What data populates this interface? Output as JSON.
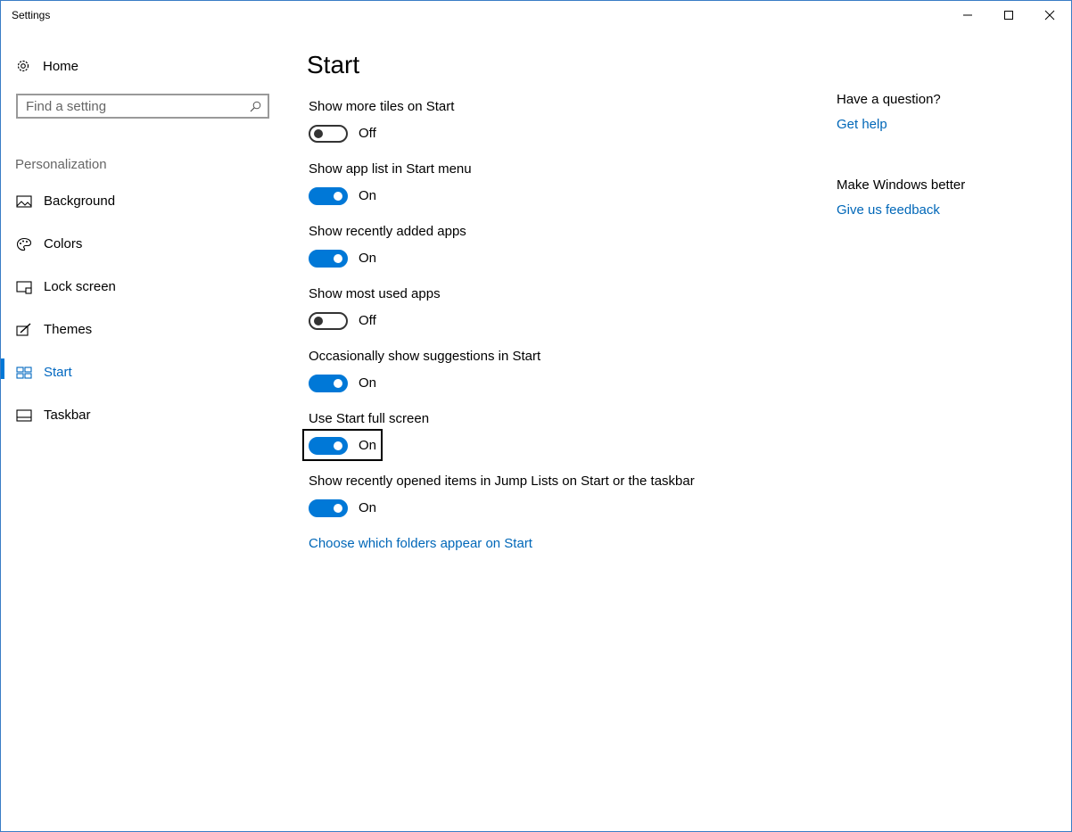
{
  "window": {
    "title": "Settings"
  },
  "nav": {
    "home_label": "Home",
    "search_placeholder": "Find a setting",
    "section_label": "Personalization",
    "items": [
      {
        "label": "Background",
        "icon": "picture-icon",
        "active": false
      },
      {
        "label": "Colors",
        "icon": "palette-icon",
        "active": false
      },
      {
        "label": "Lock screen",
        "icon": "lock-screen-icon",
        "active": false
      },
      {
        "label": "Themes",
        "icon": "themes-icon",
        "active": false
      },
      {
        "label": "Start",
        "icon": "start-icon",
        "active": true
      },
      {
        "label": "Taskbar",
        "icon": "taskbar-icon",
        "active": false
      }
    ]
  },
  "main": {
    "title": "Start",
    "settings": [
      {
        "label": "Show more tiles on Start",
        "state": "Off",
        "on": false
      },
      {
        "label": "Show app list in Start menu",
        "state": "On",
        "on": true
      },
      {
        "label": "Show recently added apps",
        "state": "On",
        "on": true
      },
      {
        "label": "Show most used apps",
        "state": "Off",
        "on": false
      },
      {
        "label": "Occasionally show suggestions in Start",
        "state": "On",
        "on": true
      },
      {
        "label": "Use Start full screen",
        "state": "On",
        "on": true,
        "focused": true
      },
      {
        "label": "Show recently opened items in Jump Lists on Start or the taskbar",
        "state": "On",
        "on": true
      }
    ],
    "folders_link": "Choose which folders appear on Start"
  },
  "aside": {
    "question_heading": "Have a question?",
    "help_link": "Get help",
    "feedback_heading": "Make Windows better",
    "feedback_link": "Give us feedback"
  },
  "colors": {
    "accent": "#0078d7",
    "link": "#0067b8",
    "window_border": "#3a7dc6"
  }
}
